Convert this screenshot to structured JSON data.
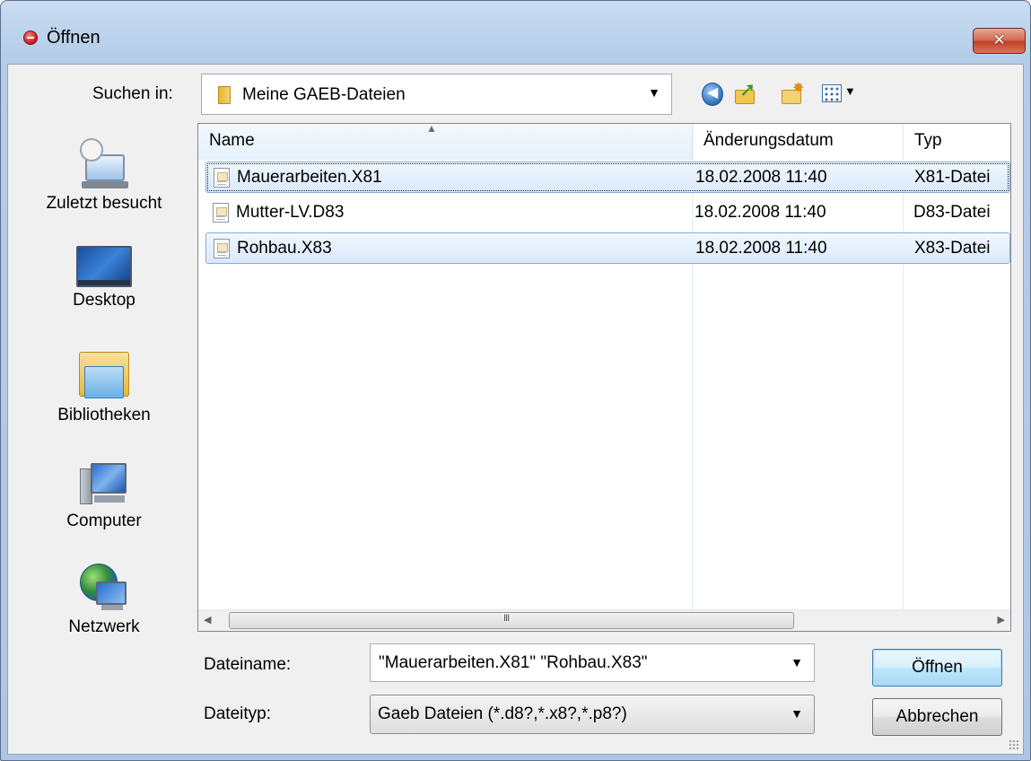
{
  "window": {
    "title": "Öffnen",
    "close_label": "✕"
  },
  "lookin": {
    "label": "Suchen in:",
    "value": "Meine GAEB-Dateien"
  },
  "toolbar": {
    "back_icon": "back-arrow-icon",
    "up_icon": "folder-up-icon",
    "new_folder_icon": "new-folder-icon",
    "views_icon": "view-menu-icon"
  },
  "places": [
    {
      "label": "Zuletzt besucht",
      "icon": "recent-places-icon"
    },
    {
      "label": "Desktop",
      "icon": "desktop-icon"
    },
    {
      "label": "Bibliotheken",
      "icon": "libraries-icon"
    },
    {
      "label": "Computer",
      "icon": "computer-icon"
    },
    {
      "label": "Netzwerk",
      "icon": "network-icon"
    }
  ],
  "columns": [
    "Name",
    "Änderungsdatum",
    "Typ"
  ],
  "files": [
    {
      "name": "Mauerarbeiten.X81",
      "date": "18.02.2008 11:40",
      "type": "X81-Datei",
      "selected": true
    },
    {
      "name": "Mutter-LV.D83",
      "date": "18.02.2008 11:40",
      "type": "D83-Datei",
      "selected": false
    },
    {
      "name": "Rohbau.X83",
      "date": "18.02.2008 11:40",
      "type": "X83-Datei",
      "selected": true
    }
  ],
  "filename": {
    "label": "Dateiname:",
    "value": "\"Mauerarbeiten.X81\" \"Rohbau.X83\""
  },
  "filetype": {
    "label": "Dateityp:",
    "value": "Gaeb Dateien (*.d8?,*.x8?,*.p8?)"
  },
  "buttons": {
    "open": "Öffnen",
    "cancel": "Abbrechen"
  },
  "scrollbar": {
    "grip": "III"
  }
}
